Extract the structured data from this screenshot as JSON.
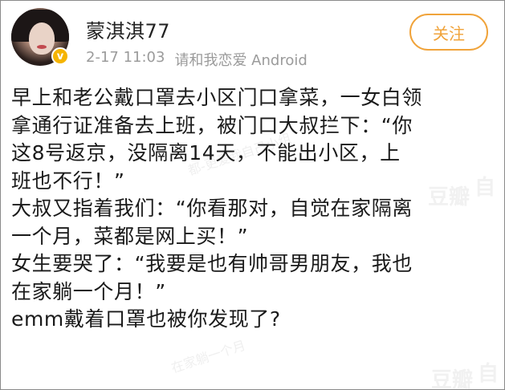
{
  "post": {
    "username": "蒙淇淇77",
    "date": "2-17 11:03",
    "source": "请和我恋爱 Android",
    "follow_label": "关注",
    "badge": "v",
    "lines": [
      "早上和老公戴口罩去小区门口拿菜，一女白领",
      "拿通行证准备去上班，被门口大叔拦下：“你",
      "这8号返京，没隔离14天，不能出小区，上",
      "班也不行！”",
      "大叔又指着我们：“你看那对，自觉在家隔离",
      "一个月，菜都是网上买！”",
      "女生要哭了：“我要是也有帅哥男朋友，我也",
      "在家躺一个月！”",
      "emm戴着口罩也被你发现了?"
    ]
  },
  "watermark": {
    "text1": "都-更爱我自己小组",
    "text2": "豆瓣",
    "text3": "自",
    "text4": "在家躺一个月",
    "text5": "豆瓣",
    "text6": "自"
  },
  "colors": {
    "follow_accent": "#f0a33a",
    "badge": "#f5b400",
    "meta_text": "#9b9b9b",
    "body_text": "#1a1a1a"
  }
}
